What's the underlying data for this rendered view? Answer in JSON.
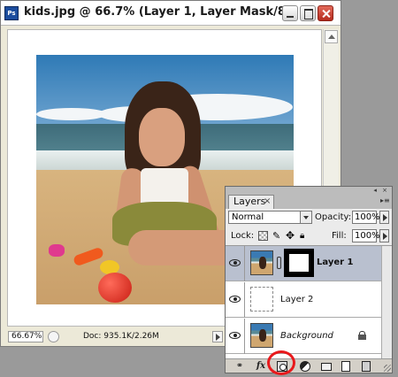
{
  "document": {
    "title": "kids.jpg @ 66.7% (Layer 1, Layer Mask/8)",
    "app_icon": "Ps",
    "zoom": "66.67%",
    "doc_info": "Doc: 935.1K/2.26M"
  },
  "layers_panel": {
    "tab_label": "Layers",
    "tab_close": "×",
    "blend_mode": "Normal",
    "opacity_label": "Opacity:",
    "opacity_value": "100%",
    "lock_label": "Lock:",
    "fill_label": "Fill:",
    "fill_value": "100%",
    "layers": [
      {
        "name": "Layer 1",
        "selected": true,
        "has_mask": true,
        "thumbnail": "photo"
      },
      {
        "name": "Layer 2",
        "selected": false,
        "has_mask": false,
        "thumbnail": "blank"
      },
      {
        "name": "Background",
        "selected": false,
        "has_mask": false,
        "thumbnail": "photo",
        "locked": true
      }
    ],
    "bottom_icons": [
      "link-icon",
      "fx-icon",
      "add-layer-mask-icon",
      "adjustment-layer-icon",
      "folder-icon",
      "new-layer-icon",
      "trash-icon"
    ],
    "fx_label": "fx",
    "highlighted_icon": "add-layer-mask-icon",
    "highlight_color": "#e8191c"
  }
}
